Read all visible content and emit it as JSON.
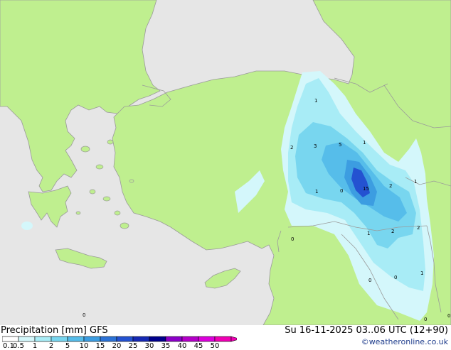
{
  "map": {
    "colors": {
      "sea": "#e6e6e6",
      "land": "#bfef8f",
      "border": "#9a9a9a",
      "coast": "#9a9a9a",
      "light_precip": "#d4f7fb",
      "precip_1": "#a8ecf6",
      "precip_2": "#78d6ef",
      "precip_5": "#56bdea",
      "precip_10": "#3c9de1",
      "precip_15": "#2452d1"
    },
    "contour_labels": [
      "1",
      "2",
      "3",
      "5",
      "1",
      "1",
      "0",
      "15",
      "2",
      "1",
      "1",
      "2",
      "2",
      "0",
      "0",
      "0",
      "1",
      "0",
      "0",
      "0"
    ]
  },
  "legend": {
    "title": "Precipitation [mm]  GFS",
    "run": "Su 16-11-2025 03..06 UTC (12+90)",
    "credit": "©weatheronline.co.uk",
    "ticks": [
      "0.1",
      "0.5",
      "1",
      "2",
      "5",
      "10",
      "15",
      "20",
      "25",
      "30",
      "35",
      "40",
      "45",
      "50"
    ],
    "colors": [
      "#ffffff",
      "#d4f7fb",
      "#a8ecf6",
      "#78d6ef",
      "#56bdea",
      "#3c9de1",
      "#2c72d6",
      "#2452d1",
      "#1629b4",
      "#00008c",
      "#8c00c8",
      "#b400c8",
      "#dc00dc",
      "#f000b4"
    ]
  }
}
